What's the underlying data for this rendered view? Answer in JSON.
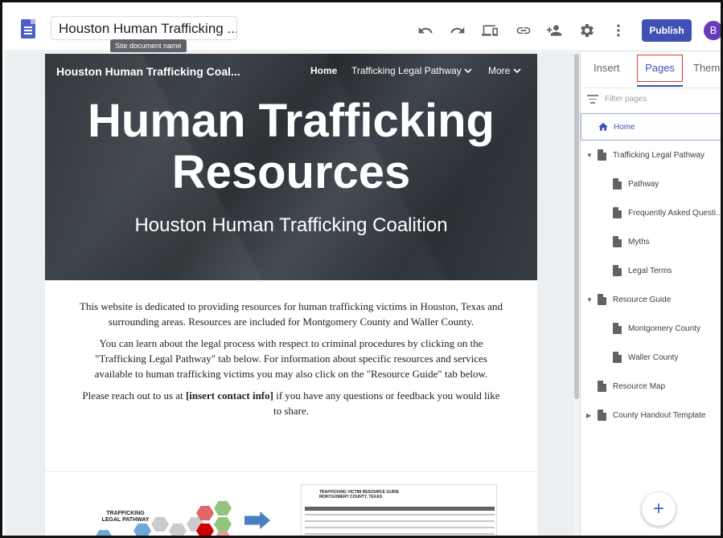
{
  "topbar": {
    "doc_name": "Houston Human Trafficking ...",
    "tooltip": "Site document name",
    "publish_label": "Publish",
    "avatar_letter": "B",
    "icons": [
      "undo-icon",
      "redo-icon",
      "preview-icon",
      "link-icon",
      "share-icon",
      "settings-icon",
      "more-vert-icon"
    ]
  },
  "site": {
    "title": "Houston Human Trafficking Coal...",
    "nav": {
      "home": "Home",
      "legal": "Trafficking Legal Pathway",
      "more": "More"
    },
    "hero_title_line1": "Human Trafficking",
    "hero_title_line2": "Resources",
    "hero_subtitle": "Houston Human Trafficking Coalition",
    "intro": {
      "p1": "This website is dedicated to providing resources for human trafficking victims in Houston, Texas and surrounding areas. Resources are included for Montgomery County and Waller County.",
      "p2": "You can learn about the legal process with respect to criminal procedures by clicking on the \"Trafficking Legal Pathway\" tab below. For information about specific resources and services available to human trafficking victims you may also click on the \"Resource Guide\" tab below.",
      "p3_before": "Please reach out to us at ",
      "p3_bold": "[insert contact info]",
      "p3_after": " if you have any questions or feedback you would like to share."
    },
    "thumb_left_title": "TRAFFICKING LEGAL PATHWAY",
    "thumb_right_title": "TRAFFICKING VICTIM RESOURCE GUIDE\nMONTGOMERY COUNTY, TEXAS"
  },
  "panel": {
    "tabs": {
      "insert": "Insert",
      "pages": "Pages",
      "themes": "Themes"
    },
    "filter_placeholder": "Filter pages",
    "pages": [
      {
        "label": "Home",
        "level": 0,
        "icon": "home-icon",
        "selected": true
      },
      {
        "label": "Trafficking Legal Pathway",
        "level": 0,
        "expanded": true
      },
      {
        "label": "Pathway",
        "level": 1
      },
      {
        "label": "Frequently Asked Questi...",
        "level": 1
      },
      {
        "label": "Myths",
        "level": 1
      },
      {
        "label": "Legal Terms",
        "level": 1
      },
      {
        "label": "Resource Guide",
        "level": 0,
        "expanded": true
      },
      {
        "label": "Montgomery County",
        "level": 1
      },
      {
        "label": "Waller County",
        "level": 1
      },
      {
        "label": "Resource Map",
        "level": 0
      },
      {
        "label": "County Handout Template",
        "level": 0,
        "expanded": false
      }
    ],
    "fab_label": "+"
  },
  "colors": {
    "accent": "#3f51b5",
    "highlight_border": "#e53935",
    "hero_bg": "#363b41"
  }
}
